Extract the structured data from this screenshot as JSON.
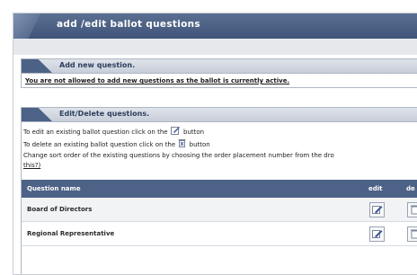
{
  "page": {
    "title": "add /edit ballot questions"
  },
  "add_panel": {
    "title": "Add new question.",
    "warning": "You are not allowed to add new questions as the ballot is currently active."
  },
  "edit_panel": {
    "title": "Edit/Delete questions.",
    "instr_edit_before": "To edit an existing ballot question click on the",
    "instr_edit_after": "button",
    "instr_delete_before": "To delete an existing ballot question click on the",
    "instr_delete_after": "button",
    "instr_sort": "Change sort order of the existing questions by choosing the order placement number from the dro",
    "instr_sort_link": "this?)"
  },
  "table": {
    "col_name": "Question name",
    "col_edit": "edit",
    "col_delete": "de",
    "rows": [
      {
        "name": "Board of Directors"
      },
      {
        "name": "Regional Representative"
      }
    ]
  },
  "icons": {
    "edit": "edit-pencil-icon",
    "delete": "delete-trash-icon"
  }
}
